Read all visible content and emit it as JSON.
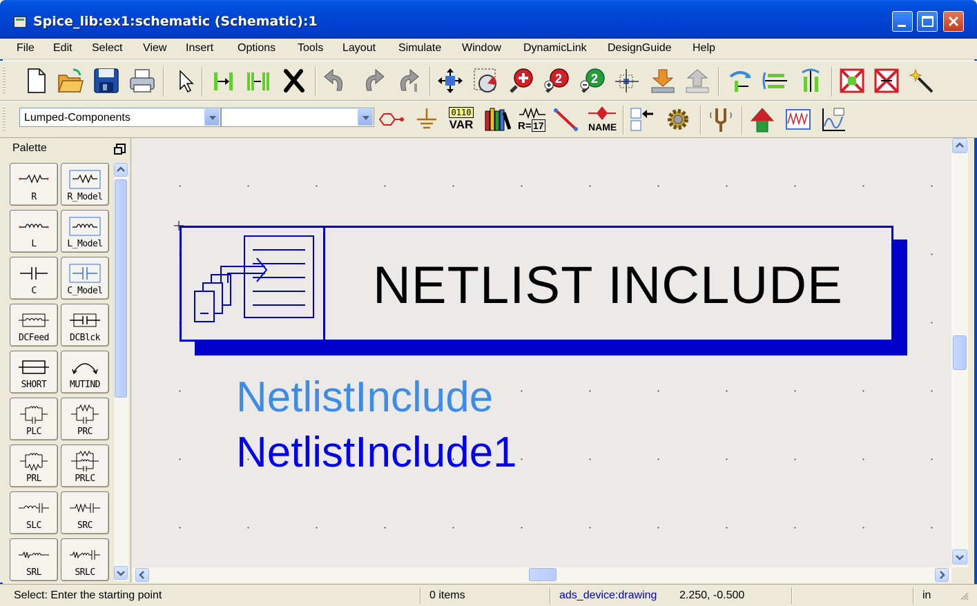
{
  "window": {
    "title": "Spice_lib:ex1:schematic (Schematic):1"
  },
  "menu": [
    "File",
    "Edit",
    "Select",
    "View",
    "Insert",
    "Options",
    "Tools",
    "Layout",
    "Simulate",
    "Window",
    "DynamicLink",
    "DesignGuide",
    "Help"
  ],
  "toolbar2": {
    "palette_combo": "Lumped-Components",
    "component_combo": "",
    "var_label_top": "0110",
    "var_label": "VAR",
    "r17_label": "R=",
    "r17_value": "17",
    "name_label": "NAME"
  },
  "palette": {
    "title": "Palette",
    "items": [
      "R",
      "R_Model",
      "L",
      "L_Model",
      "C",
      "C_Model",
      "DCFeed",
      "DCBlck",
      "SHORT",
      "MUTIND",
      "PLC",
      "PRC",
      "PRL",
      "PRLC",
      "SLC",
      "SRC",
      "SRL",
      "SRLC"
    ]
  },
  "canvas": {
    "component_title": "NETLIST  INCLUDE",
    "instance_type": "NetlistInclude",
    "instance_name": "NetlistInclude1"
  },
  "status": {
    "prompt": "Select: Enter the starting point",
    "count": "0 items",
    "layer": "ads_device:drawing",
    "coords": "2.250, -0.500",
    "units": "in"
  },
  "colors": {
    "titlebar": "#0046D5",
    "component_border": "#0000cc",
    "instance_type": "#3d8de8",
    "instance_name": "#0000ee"
  }
}
